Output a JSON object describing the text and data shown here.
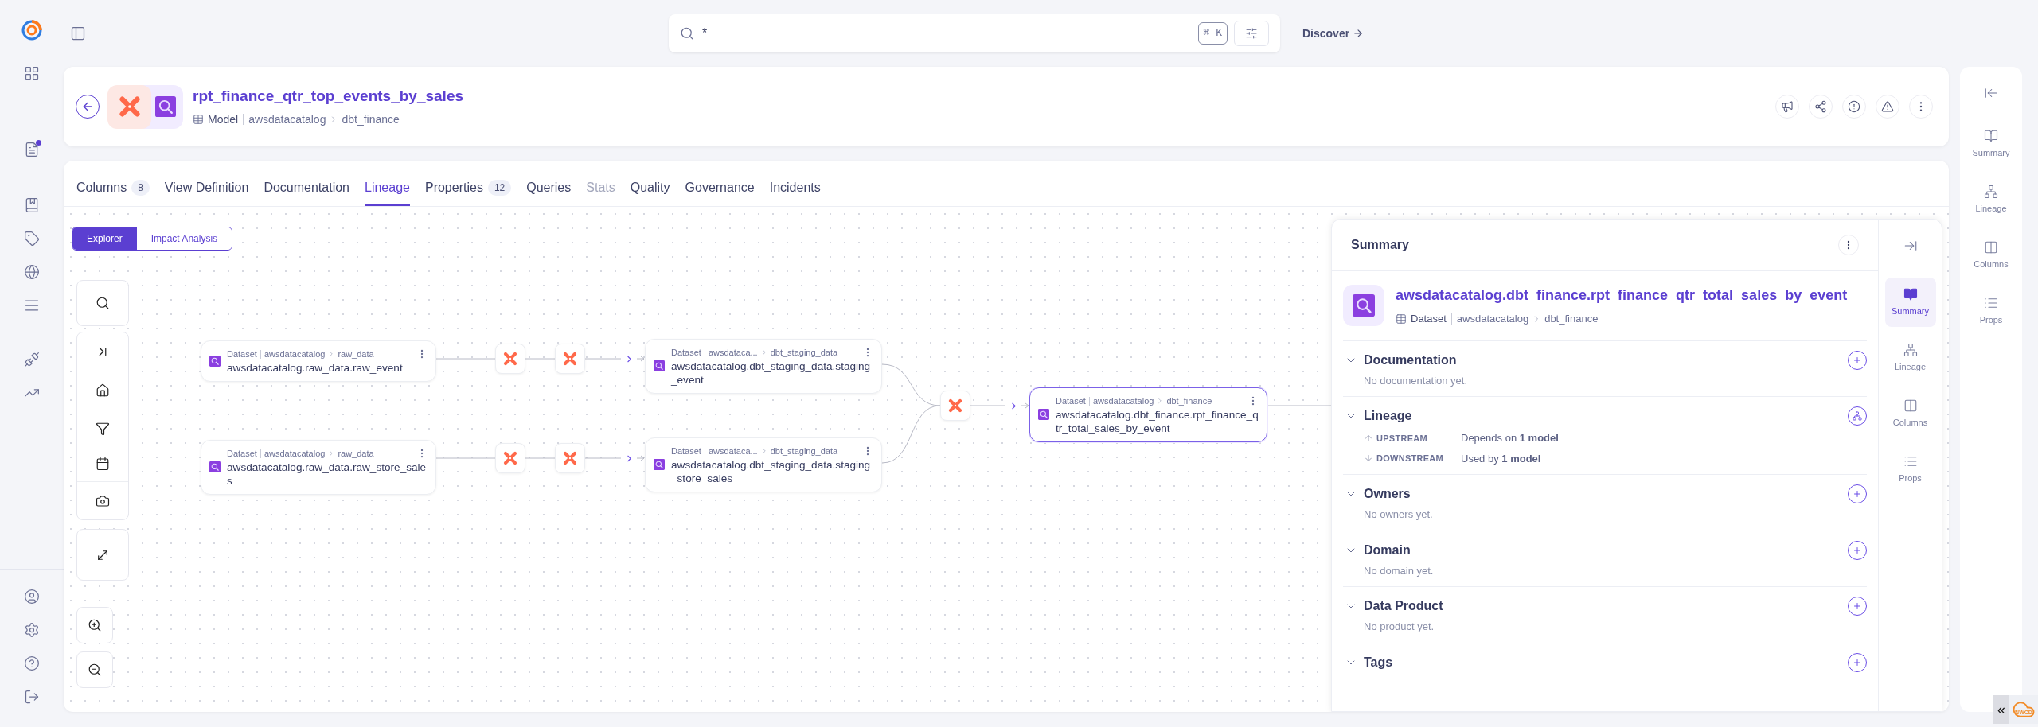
{
  "nav": {
    "notification_dot": true
  },
  "top_bar": {
    "search": {
      "value": "*",
      "shortcut": "⌘ K"
    },
    "discover": "Discover"
  },
  "header": {
    "title": "rpt_finance_qtr_top_events_by_sales",
    "type": "Model",
    "breadcrumb": [
      "awsdatacatalog",
      "dbt_finance"
    ]
  },
  "tabs": [
    {
      "label": "Columns",
      "count": "8",
      "selected": false,
      "disabled": false
    },
    {
      "label": "View Definition",
      "selected": false,
      "disabled": false
    },
    {
      "label": "Documentation",
      "selected": false,
      "disabled": false
    },
    {
      "label": "Lineage",
      "selected": true,
      "disabled": false
    },
    {
      "label": "Properties",
      "count": "12",
      "selected": false,
      "disabled": false
    },
    {
      "label": "Queries",
      "selected": false,
      "disabled": false
    },
    {
      "label": "Stats",
      "selected": false,
      "disabled": true
    },
    {
      "label": "Quality",
      "selected": false,
      "disabled": false
    },
    {
      "label": "Governance",
      "selected": false,
      "disabled": false
    },
    {
      "label": "Incidents",
      "selected": false,
      "disabled": false
    }
  ],
  "view_toggle": [
    {
      "label": "Explorer",
      "selected": true
    },
    {
      "label": "Impact Analysis",
      "selected": false
    }
  ],
  "lineage": {
    "nodes": [
      {
        "type": "Dataset",
        "path": [
          "awsdatacatalog",
          "raw_data"
        ],
        "name": "awsdatacatalog.raw_data.raw_event",
        "selected": false
      },
      {
        "type": "Dataset",
        "path": [
          "awsdatacatalog",
          "raw_data"
        ],
        "name": "awsdatacatalog.raw_data.raw_store_sales",
        "selected": false
      },
      {
        "type": "Dataset",
        "path": [
          "awsdataca...",
          "dbt_staging_data"
        ],
        "name": "awsdatacatalog.dbt_staging_data.staging_event",
        "selected": false
      },
      {
        "type": "Dataset",
        "path": [
          "awsdataca...",
          "dbt_staging_data"
        ],
        "name": "awsdatacatalog.dbt_staging_data.staging_store_sales",
        "selected": false
      },
      {
        "type": "Dataset",
        "path": [
          "awsdatacatalog",
          "dbt_finance"
        ],
        "name": "awsdatacatalog.dbt_finance.rpt_finance_qtr_total_sales_by_event",
        "selected": true
      }
    ]
  },
  "summary": {
    "title": "Summary",
    "entity": {
      "name": "awsdatacatalog.dbt_finance.rpt_finance_qtr_total_sales_by_event",
      "type": "Dataset",
      "breadcrumb": [
        "awsdatacatalog",
        "dbt_finance"
      ]
    },
    "sections": [
      {
        "title": "Documentation",
        "kind": "empty",
        "expanded": true,
        "text": "No documentation yet."
      },
      {
        "title": "Lineage",
        "kind": "lineage",
        "expanded": true,
        "rows": [
          {
            "kind": "up",
            "label": "UPSTREAM",
            "text": "Depends on **1 model**"
          },
          {
            "kind": "down",
            "label": "DOWNSTREAM",
            "text": "Used by **1 model**"
          }
        ]
      },
      {
        "title": "Owners",
        "kind": "empty",
        "expanded": true,
        "text": "No owners yet."
      },
      {
        "title": "Domain",
        "kind": "empty",
        "expanded": true,
        "text": "No domain yet."
      },
      {
        "title": "Data Product",
        "kind": "empty",
        "expanded": true,
        "text": "No product yet."
      },
      {
        "title": "Tags",
        "kind": "empty",
        "expanded": true
      }
    ],
    "rail": [
      {
        "label": "Summary",
        "selected": true
      },
      {
        "label": "Lineage",
        "selected": false
      },
      {
        "label": "Columns",
        "selected": false
      },
      {
        "label": "Props",
        "selected": false
      }
    ]
  },
  "right_rail": [
    {
      "label": "Summary",
      "selected": false
    },
    {
      "label": "Lineage",
      "selected": false
    },
    {
      "label": "Columns",
      "selected": false
    },
    {
      "label": "Props",
      "selected": false
    }
  ],
  "corner_widget": {
    "glyph": "«",
    "logo_text": "NWCD"
  }
}
